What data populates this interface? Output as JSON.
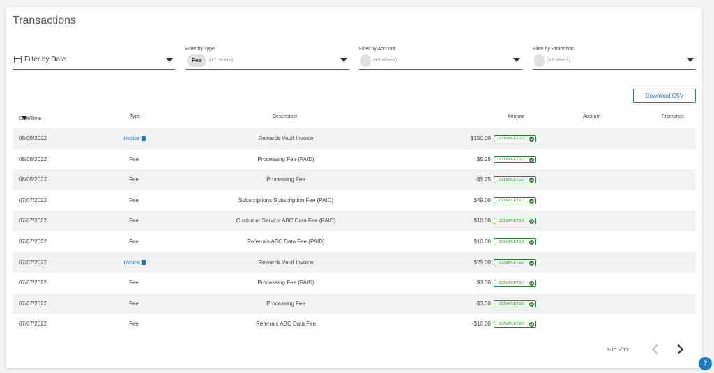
{
  "page": {
    "title": "Transactions"
  },
  "filters": {
    "date": {
      "label": "Filter by Date"
    },
    "type": {
      "label": "Filter by Type",
      "chip": "Fee",
      "others": "(+7 others)"
    },
    "account": {
      "label": "Filter by Account",
      "others": "(+3 others)"
    },
    "promotion": {
      "label": "Filter by Promotion",
      "others": "(+2 others)"
    }
  },
  "toolbar": {
    "download_label": "Download CSV"
  },
  "table": {
    "headers": {
      "date": "Date/Time",
      "type": "Type",
      "description": "Description",
      "amount": "Amount",
      "account": "Account",
      "promotion": "Promotion"
    },
    "rows": [
      {
        "date": "08/05/2022",
        "type": "Invoice",
        "link": true,
        "description": "Rewards Vault Invoice",
        "amount": "$150.00",
        "status": "COMPLETED"
      },
      {
        "date": "08/05/2022",
        "type": "Fee",
        "link": false,
        "description": "Processing Fee (PAID)",
        "amount": "$5.25",
        "status": "COMPLETED"
      },
      {
        "date": "08/05/2022",
        "type": "Fee",
        "link": false,
        "description": "Processing Fee",
        "amount": "-$5.25",
        "status": "COMPLETED"
      },
      {
        "date": "07/07/2022",
        "type": "Fee",
        "link": false,
        "description": "Subscriptions Subscription Fee (PAID)",
        "amount": "$49.00",
        "status": "COMPLETED"
      },
      {
        "date": "07/07/2022",
        "type": "Fee",
        "link": false,
        "description": "Customer Service ABC Data Fee (PAID)",
        "amount": "$10.00",
        "status": "COMPLETED"
      },
      {
        "date": "07/07/2022",
        "type": "Fee",
        "link": false,
        "description": "Referrals ABC Data Fee (PAID)",
        "amount": "$10.00",
        "status": "COMPLETED"
      },
      {
        "date": "07/07/2022",
        "type": "Invoice",
        "link": true,
        "description": "Rewards Vault Invoice",
        "amount": "$25.00",
        "status": "COMPLETED"
      },
      {
        "date": "07/07/2022",
        "type": "Fee",
        "link": false,
        "description": "Processing Fee (PAID)",
        "amount": "$3.30",
        "status": "COMPLETED"
      },
      {
        "date": "07/07/2022",
        "type": "Fee",
        "link": false,
        "description": "Processing Fee",
        "amount": "-$3.30",
        "status": "COMPLETED"
      },
      {
        "date": "07/07/2022",
        "type": "Fee",
        "link": false,
        "description": "Referrals ABC Data Fee",
        "amount": "-$10.00",
        "status": "COMPLETED"
      }
    ]
  },
  "pagination": {
    "range": "1-10 of 77"
  },
  "help": {
    "label": "?"
  },
  "colors": {
    "accent": "#1f7bc1",
    "status_green": "#2e7d32",
    "row_alt": "#f2f2f2"
  },
  "icons": {
    "date_filter": "calendar-icon",
    "dropdown": "caret-down-icon",
    "sort": "sort-desc-icon",
    "invoice": "document-icon",
    "status": "check-circle-icon",
    "prev": "chevron-left-icon",
    "next": "chevron-right-icon"
  }
}
